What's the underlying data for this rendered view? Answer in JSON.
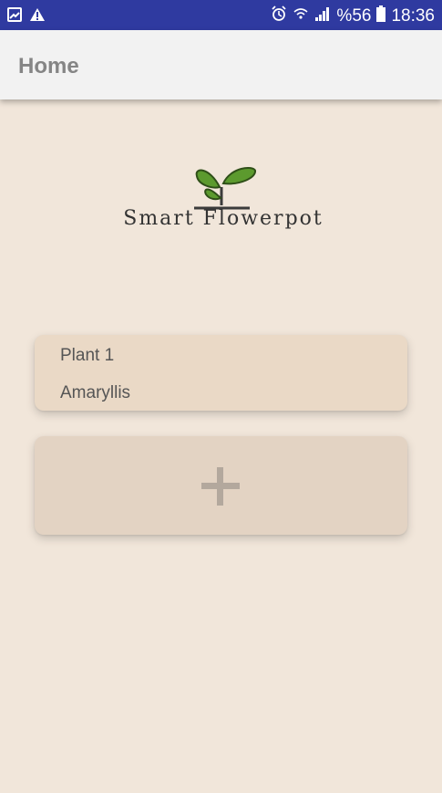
{
  "status_bar": {
    "icons_left": [
      "gallery-icon",
      "warning-icon"
    ],
    "icons_right": [
      "alarm-icon",
      "wifi-icon",
      "signal-icon",
      "battery-icon"
    ],
    "battery": "%56",
    "time": "18:36"
  },
  "app_bar": {
    "title": "Home"
  },
  "logo": {
    "text": "Smart Flowerpot"
  },
  "plants": [
    {
      "name": "Plant 1",
      "species": "Amaryllis"
    }
  ],
  "add_button": {
    "icon": "plus-icon"
  },
  "colors": {
    "status_bar": "#2f3aa0",
    "background": "#f1e6da",
    "plant_card": "#ead9c6",
    "add_card": "#e3d3c3",
    "leaf": "#5c9a2e"
  }
}
